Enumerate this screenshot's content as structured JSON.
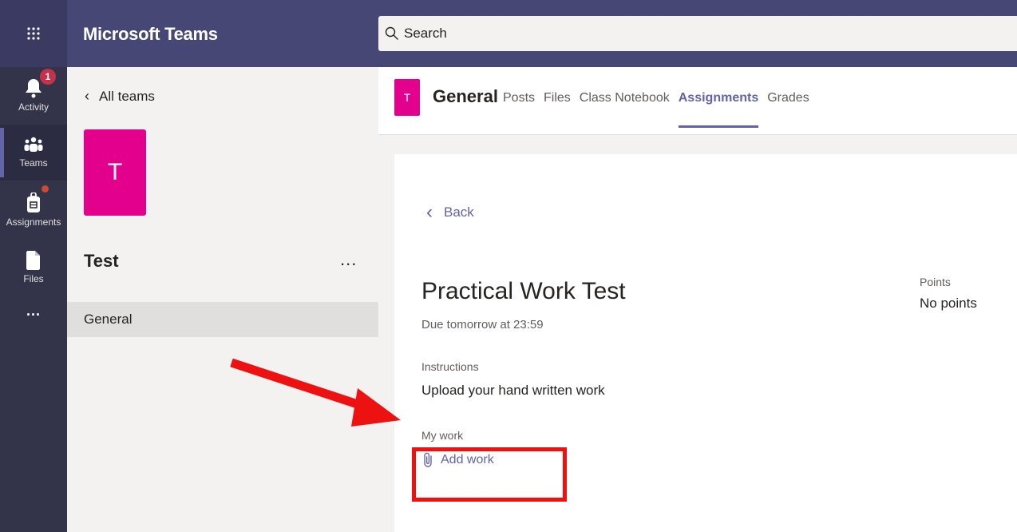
{
  "app": {
    "title": "Microsoft Teams"
  },
  "search": {
    "placeholder": "Search"
  },
  "rail": {
    "items": [
      {
        "label": "Activity",
        "icon": "bell-icon",
        "badge": "1"
      },
      {
        "label": "Teams",
        "icon": "teams-icon",
        "active": true
      },
      {
        "label": "Assignments",
        "icon": "assignments-icon",
        "dot": true
      },
      {
        "label": "Files",
        "icon": "file-icon"
      },
      {
        "label": "...",
        "icon": "more-icon"
      }
    ]
  },
  "sidebar": {
    "back_label": "All teams",
    "team_initial": "T",
    "team_name": "Test",
    "more": "...",
    "channels": [
      {
        "label": "General",
        "selected": true
      }
    ]
  },
  "channel": {
    "icon_initial": "T",
    "name": "General",
    "tabs": [
      {
        "label": "Posts"
      },
      {
        "label": "Files"
      },
      {
        "label": "Class Notebook"
      },
      {
        "label": "Assignments",
        "active": true
      },
      {
        "label": "Grades"
      }
    ]
  },
  "assignment": {
    "back_label": "Back",
    "title": "Practical Work Test",
    "due": "Due tomorrow at 23:59",
    "points_label": "Points",
    "points_value": "No points",
    "instructions_label": "Instructions",
    "instructions_text": "Upload your hand written work",
    "my_work_label": "My work",
    "add_work_label": "Add work"
  },
  "colors": {
    "header": "#464775",
    "rail": "#33344a",
    "accent": "#6264a7",
    "team_tile": "#e3008c",
    "annotation": "#ee1111"
  }
}
